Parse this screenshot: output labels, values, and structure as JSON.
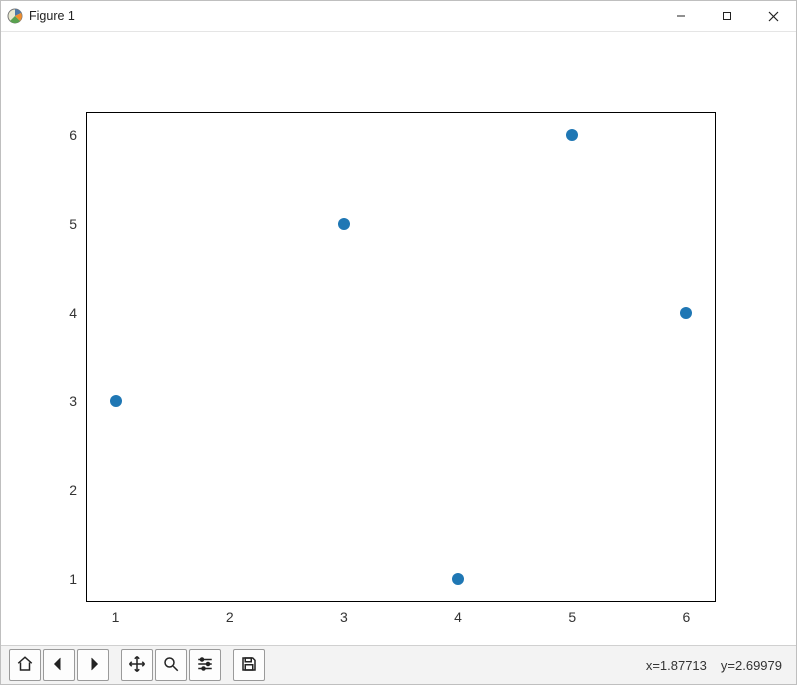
{
  "window": {
    "title": "Figure 1"
  },
  "statusbar": {
    "x_label": "x=1.87713",
    "y_label": "y=2.69979"
  },
  "toolbar": {
    "home": "Home",
    "back": "Back",
    "forward": "Forward",
    "pan": "Pan",
    "zoom": "Zoom",
    "configure": "Configure subplots",
    "save": "Save"
  },
  "chart_data": {
    "type": "scatter",
    "x": [
      1,
      3,
      4,
      5,
      6
    ],
    "y": [
      3,
      5,
      1,
      6,
      4
    ],
    "x_ticks": [
      1,
      2,
      3,
      4,
      5,
      6
    ],
    "y_ticks": [
      1,
      2,
      3,
      4,
      5,
      6
    ],
    "xlim": [
      0.75,
      6.25
    ],
    "ylim": [
      0.75,
      6.25
    ],
    "marker_color": "#1f77b4",
    "title": "",
    "xlabel": "",
    "ylabel": ""
  }
}
